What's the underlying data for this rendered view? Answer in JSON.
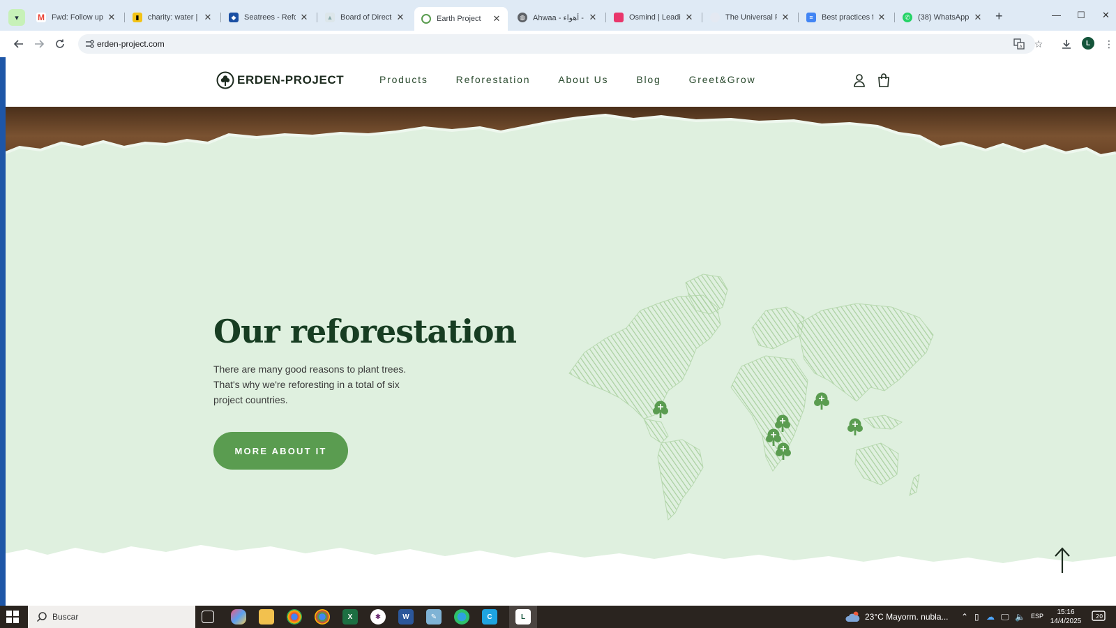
{
  "browser": {
    "tabs": [
      {
        "title": "Fwd: Follow up: Pr",
        "icon": "gmail-icon",
        "color": "#ea4335",
        "active": false
      },
      {
        "title": "charity: water | He",
        "icon": "charity-water-icon",
        "color": "#f3c316",
        "active": false
      },
      {
        "title": "Seatrees - Refores",
        "icon": "seatrees-icon",
        "color": "#1a4fa3",
        "active": false
      },
      {
        "title": "Board of Director",
        "icon": "board-icon",
        "color": "#c8d4d8",
        "active": false
      },
      {
        "title": "Earth Project",
        "icon": "earth-project-icon",
        "color": "#5a9c50",
        "active": true
      },
      {
        "title": "Ahwaa - أهواء - Ar",
        "icon": "globe-icon",
        "color": "#5f6368",
        "active": false
      },
      {
        "title": "Osmind | Leading",
        "icon": "osmind-icon",
        "color": "#e9366b",
        "active": false
      },
      {
        "title": "The Universal Pea",
        "icon": "universal-peace-icon",
        "color": "#b8c3d6",
        "active": false
      },
      {
        "title": "Best practices for",
        "icon": "google-docs-icon",
        "color": "#4285f4",
        "active": false
      },
      {
        "title": "(38) WhatsApp",
        "icon": "whatsapp-icon",
        "color": "#25d366",
        "active": false
      }
    ],
    "new_tab": "+",
    "window_controls": {
      "minimize": "—",
      "maximize": "☐",
      "close": "✕"
    },
    "url": "erden-project.com",
    "profile_initial": "L"
  },
  "site": {
    "logo_text": "ERDEN-PROJECT",
    "nav": [
      "Products",
      "Reforestation",
      "About Us",
      "Blog",
      "Greet&Grow"
    ],
    "hero": {
      "title": "Our reforestation",
      "description": "There are many good reasons to plant trees. That's why we're reforesting in a total of six project countries.",
      "cta": "MORE ABOUT IT"
    },
    "accent_color": "#5a9c50",
    "hero_bg": "#dff0df"
  },
  "taskbar": {
    "search_placeholder": "Buscar",
    "weather": "23°C  Mayorm. nubla...",
    "language": "ESP",
    "time": "15:16",
    "date": "14/4/2025",
    "notifications": "20"
  }
}
